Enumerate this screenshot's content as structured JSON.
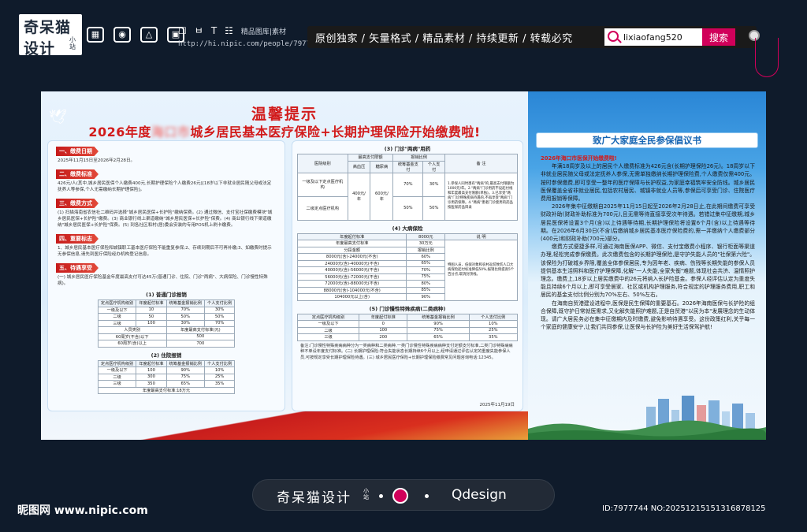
{
  "site": {
    "brand_line1": "奇呆猫",
    "brand_line2": "设计",
    "brand_small": "小站",
    "toolbar_mini": "精品图库|素材",
    "url": "http://hi.nipic.com/people/7977744/index.html",
    "slogan": "原创独家 / 矢量格式 / 精品素材 / 持续更新 / 转载必究",
    "search_value": "lixiaofang520",
    "search_button": "搜索"
  },
  "poster": {
    "title1": "温馨提示",
    "title2_pre": "2026年度",
    "title2_blur": "海口市",
    "title2_post": "城乡居民基本医疗保险+长期护理保险开始缴费啦!",
    "sections": [
      {
        "tag": "一、缴费日期",
        "text": "2025年11月15日至2026年2月28日。"
      },
      {
        "tag": "二、缴费标准",
        "text": "426元/人(其中,城乡居民医保个人缴费400元,长期护理保险个人缴费26元)[18岁以下非就业居民随父母或法定抚养人等参保,个人无需缴纳长期护理保险]。"
      },
      {
        "tag": "三、缴费方式",
        "text": "(1) 扫描海南省农信社二维码并选择\"城乡居民医保+长护险\"缴纳保费。(2) 通过微信、支付宝社保缴费模块\"城乡居民医保+长护险\"缴费。(3) 商业银行线上渠道缴纳\"城乡居民医保+长护险\"保费。(4) 商业银行线下渠道缴纳\"城乡居民医保+长护险\"保费。(5) 到各社区和村(居)委会安装的专用POS机上刷卡缴费。"
      },
      {
        "tag": "四、重要标志",
        "text": "1、城乡居民基本医疗保险和城镇职工基本医疗保险不能重复参保;2、存续到期后不可再补缴;3、如缴费时提示无参保信息,请先到医疗保险经办机构登记信息。"
      },
      {
        "tag": "五、待遇享受",
        "text": "(一) 城乡居民医疗保险基金年度最高支付可达45万(普通门诊、住院、门诊\"两病\"、大病保险、门诊慢性特殊病)。"
      }
    ],
    "outpatient": {
      "title": "(1) 普通门诊报销",
      "headers": [
        "定点医疗机构级别",
        "年度起付标准",
        "统筹基金报销比例",
        "个人支付比例"
      ],
      "rows": [
        [
          "一级及以下",
          "10",
          "70%",
          "30%"
        ],
        [
          "二级",
          "50",
          "50%",
          "50%"
        ],
        [
          "三级",
          "100",
          "30%",
          "70%"
        ]
      ],
      "sub_headers": [
        "人员类别",
        "年度最高支付标准(元)"
      ],
      "sub_rows": [
        [
          "60周岁(不含)以下",
          "500"
        ],
        [
          "60周岁(含)以上",
          "700"
        ]
      ]
    },
    "inpatient": {
      "title": "(2) 住院报销",
      "headers": [
        "定点医疗机构级别",
        "年度起付标准",
        "统筹基金报销比例",
        "个人支付比例"
      ],
      "rows": [
        [
          "一级及以下",
          "100",
          "90%",
          "10%"
        ],
        [
          "二级",
          "300",
          "75%",
          "25%"
        ],
        [
          "三级",
          "350",
          "65%",
          "35%"
        ]
      ],
      "footer": "年度最高支付标准:18万元"
    },
    "two_disease": {
      "title": "(3) 门诊\"两病\"用药",
      "headers": [
        "医院级别",
        "最高支付限额",
        "",
        "报销比例",
        "",
        "备 注"
      ],
      "sub_headers": [
        "",
        "高血压",
        "糖尿病",
        "统筹基金支付",
        "个人支付",
        ""
      ],
      "rows": [
        [
          "一级及以下定点医疗机构",
          "400元/年",
          "600元/年",
          "70%",
          "30%"
        ],
        [
          "二级定点医疗机构",
          "",
          "",
          "50%",
          "50%"
        ]
      ],
      "note": "1.参保人同时患有\"两病\"的,最高支付限额为1000元/年。2.\"两病\"门诊用药不设起付线和年度最高支付限额(单独)。3.已享受\"两病\"门诊特殊疾病待遇的,不再享受\"两病\"门诊用药保障。4.\"两病\"患者门诊使用的药品按医保药品目录"
    },
    "serious": {
      "title": "(4) 大病保险",
      "headers": [
        "年度起付标准",
        "8000元",
        "说 明"
      ],
      "limit_label": "年度最高支付标准",
      "limit_value": "30万元",
      "seg_headers": [
        "分段金额",
        "报销比例"
      ],
      "rows": [
        [
          "8000元(含)-24000元(不含)",
          "60%"
        ],
        [
          "24000元(含)-40000元(不含)",
          "65%"
        ],
        [
          "40000元(含)-56000元(不含)",
          "70%"
        ],
        [
          "56000元(含)-72000元(不含)",
          "75%"
        ],
        [
          "72000元(含)-88000元(不含)",
          "80%"
        ],
        [
          "88000元(含)-104000元(不含)",
          "85%"
        ],
        [
          "104000元以上(含)",
          "90%"
        ]
      ],
      "note": "特困人员、低保对象和农村返贫致贫人口大病保险起付标准降低50%,报销比例提高5个百分点,取消封顶线。"
    },
    "chronic": {
      "title": "(5) 门诊慢性特殊疾病(二类病种)",
      "headers": [
        "定点医疗机构级别",
        "年度起付标准",
        "统筹基金报销比例",
        "个人支付比例"
      ],
      "rows": [
        [
          "一级及以下",
          "0",
          "90%",
          "10%"
        ],
        [
          "二级",
          "100",
          "75%",
          "25%"
        ],
        [
          "三级",
          "200",
          "65%",
          "35%"
        ]
      ]
    },
    "notes": "备注:门诊慢性特殊疾病病种分为一类病种和二类病种,一类门诊慢性特殊疾病病种支付定额支付标准,二类门诊特殊病病种不单设年度支付标准。(二) 长期护理保险:符合失能状态长期持续6个月以上,经申请通过评估认定的重度失能参保人员,可按规定享受长期护理保险待遇。(三) 城乡居民医疗保险+长期护理保险缴费常见问题咨询电话:12345。",
    "date": "2025年11月19日",
    "right_title": "致广大家庭全民参保倡议书",
    "right_sub": "2026年海口市医保开始缴费啦!",
    "right_p1": "年满18周岁及以上的居民个人缴费标准为426元含(长期护理保险26元)。18周岁以下非就业居民随父母或法定抚养人参保,无需单独缴纳长期护理保险费,个人缴费仅需400元。按时参保缴费,即可享受一整年的医疗保障与长护权益,为家庭幸福筑牢安全防线。城乡居民医保覆盖全省非就业居民,包括农村居民、城镇非就业人员等,参保后可享受门诊、住院医疗费用报销等保障。",
    "right_p2": "2026年集中征缴期自2025年11月15日起至2026年2月28日止,在此期间缴费可享受财政补助(财政补助标准为700元),且无需等待直接享受次年待遇。若错过集中征缴期,城乡居民医保将设置3个月(含)以上待遇等待期,长期护理保险将设置6个月(含)以上待遇等待期。在2026年6月30日(不含)后缴纳城乡居民基本医疗保险费的,需一并缴纳个人缴费部分(400元)和财政补助(700元)部分。",
    "right_p3": "缴费方式便捷多样,可通过海南医保APP、微信、支付宝缴费小程序、银行柜面等渠道办理,轻松完成参保缴费。此次缴费包含的长期护理保险,是守护失能人员的\"社保第六险\"。该保险为打破城乡界限,覆盖全体参保居民,专为因年老、疾病、伤残等长期失能的参保人员提供基本生活照料和医疗护理保障,化解\"一人失能,全家失衡\"难题,体现社会共济、温情照护理念。缴费上,18岁以上居民缴费中的26元将纳入长护险基金。参保人经评估认定为重度失能且持续6个月以上,即可享受居家、社区或机构护理服务,符合规定的护理服务费用,职工和居民的基金支付比例分别为70%左右、50%左右。",
    "right_p4": "在海南自贸港建设进程中,医保是民生保障的重要基石。2026年海南医保与长护险的组合保障,既守护日常就医需求,又化解失能照护难题,正是自贸港\"以民为本\"发展理念的生动体现。请广大居民务必在集中征缴期内及时缴费,避免影响待遇享受。这份政策红利,关乎每一个家庭的健康安宁,让我们共同参保,让医保与长护险为美好生活保驾护航!"
  },
  "footer": {
    "brand": "奇呆猫设计",
    "brand_small": "小站",
    "designer": "Qdesign",
    "site": "昵图网 www.nipic.com",
    "id": "ID:7977744 NO:20251215151316878125"
  },
  "colors": {
    "accent": "#d21b1b",
    "brand_pink": "#d1005a",
    "blue": "#1665b3"
  }
}
